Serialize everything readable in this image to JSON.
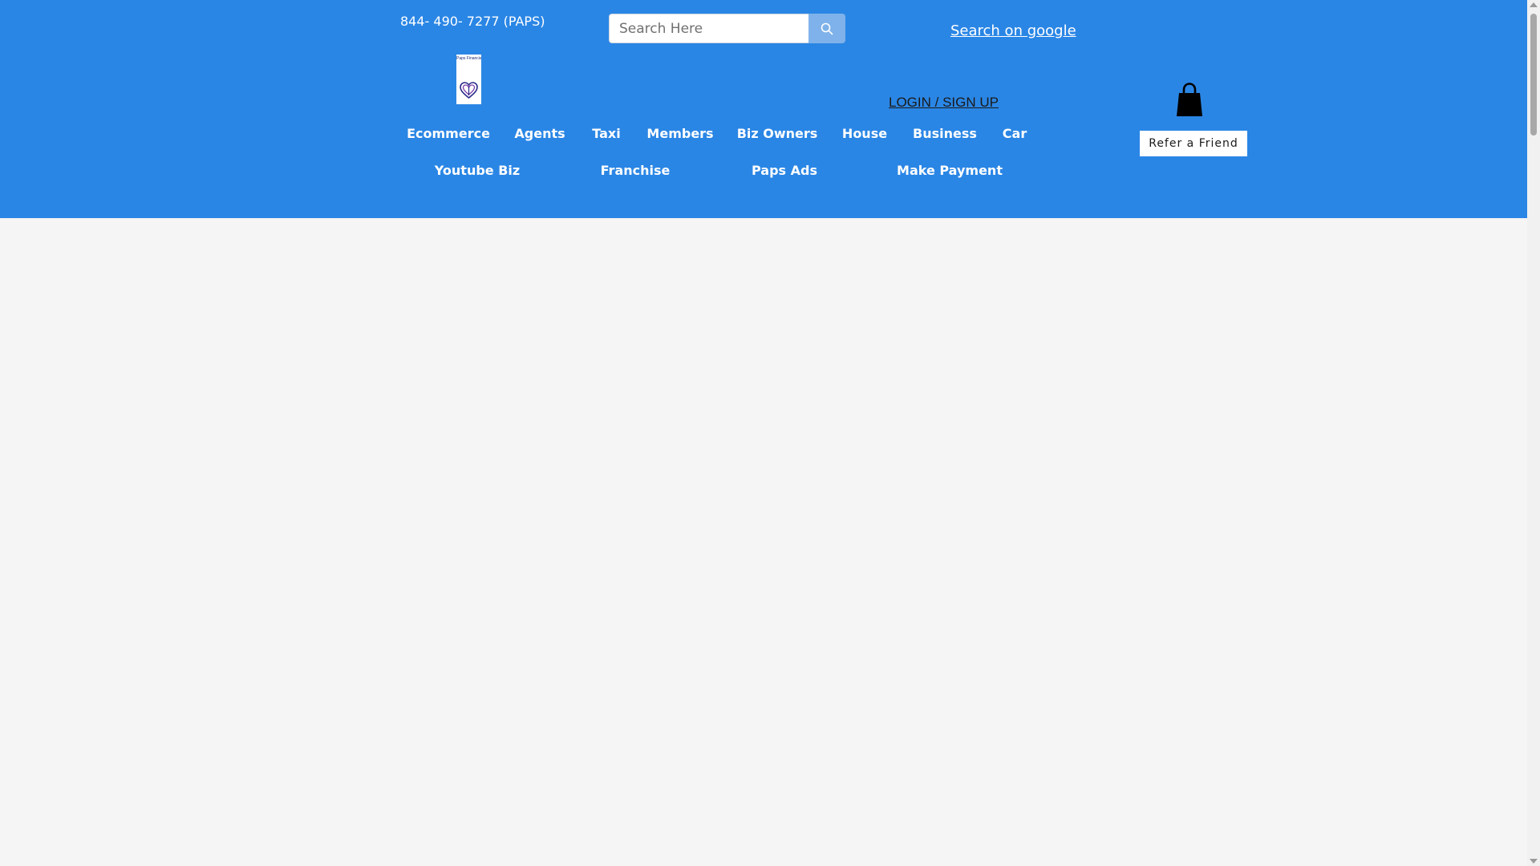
{
  "header": {
    "phone": "844- 490- 7277 (PAPS)",
    "search": {
      "placeholder": "Search Here",
      "value": "",
      "button_icon": "search-icon"
    },
    "search_google_label": "Search on google",
    "logo": {
      "text": "Paps Financial",
      "icon": "heart-logo-icon"
    },
    "login_label": "LOGIN / SIGN UP",
    "cart_icon": "shopping-bag-icon",
    "refer_label": "Refer a Friend"
  },
  "nav": {
    "row1": [
      "Ecommerce",
      "Agents",
      "Taxi",
      "Members",
      "Biz Owners",
      "House",
      "Business",
      "Car"
    ],
    "row2": [
      "Youtube Biz",
      "Franchise",
      "Paps Ads",
      "Make Payment"
    ]
  },
  "colors": {
    "header_bg": "#2a86e5",
    "page_bg": "#f5f5f5",
    "search_button_bg": "#7fb2ea"
  }
}
